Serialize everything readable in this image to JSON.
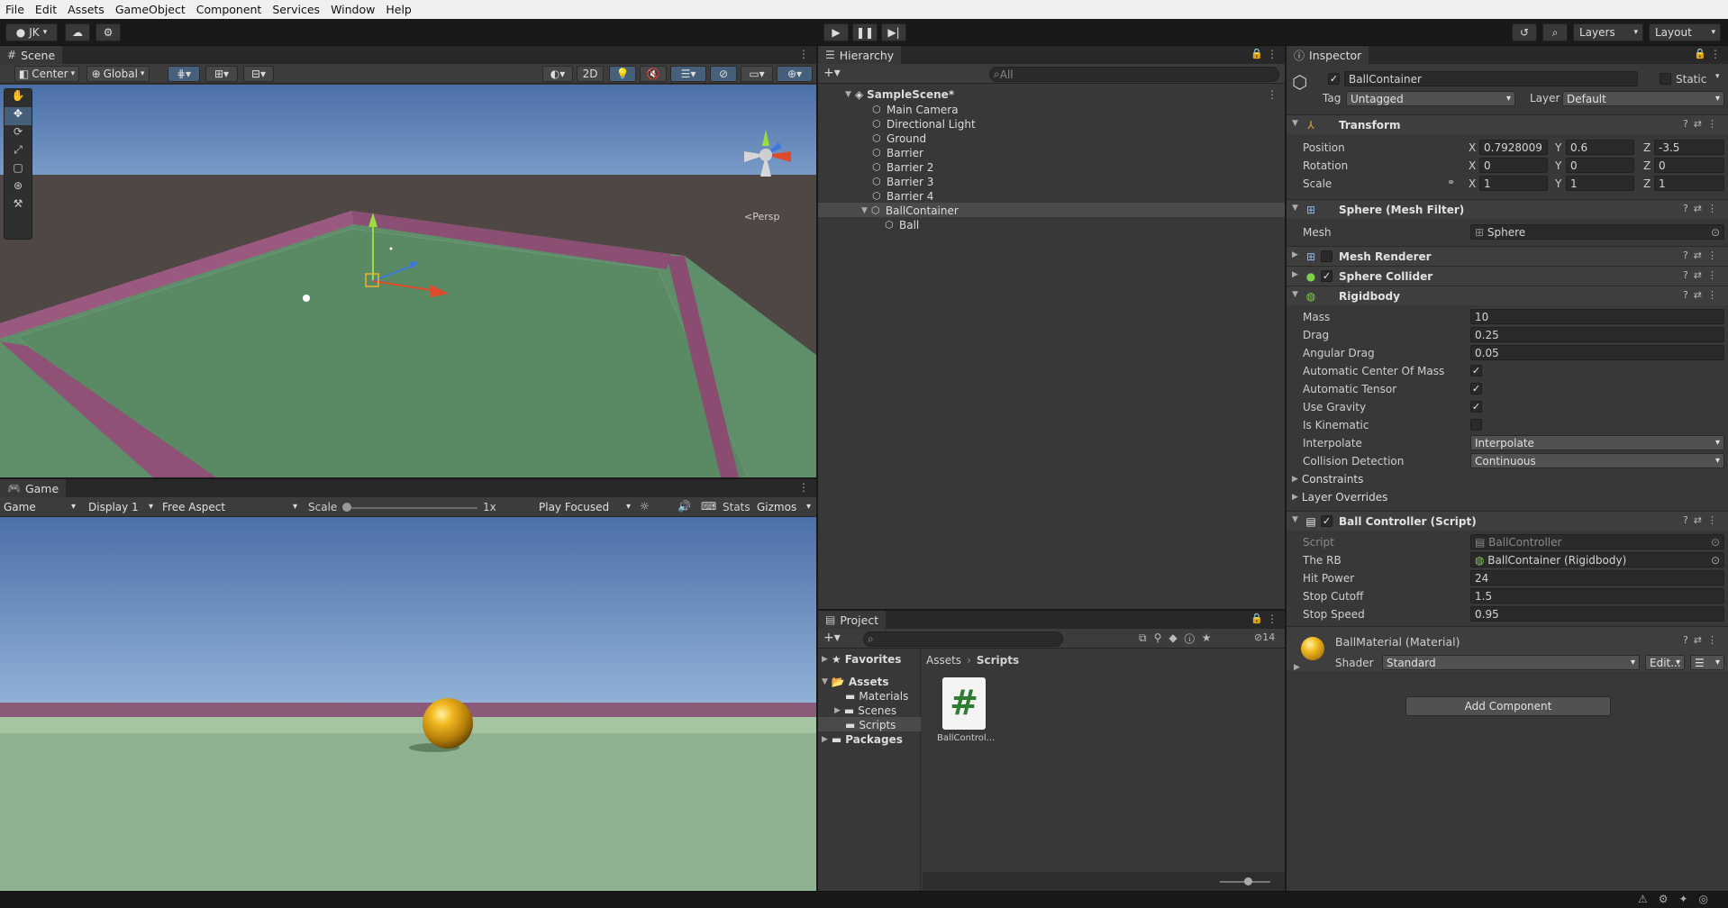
{
  "menu": [
    "File",
    "Edit",
    "Assets",
    "GameObject",
    "Component",
    "Services",
    "Window",
    "Help"
  ],
  "toolbar": {
    "account": "JK",
    "layers": "Layers",
    "layout": "Layout"
  },
  "scene": {
    "tab": "Scene",
    "pivot": "Center",
    "space": "Global",
    "mode2d": "2D",
    "gizmo_label": "<Persp"
  },
  "game": {
    "tab": "Game",
    "mode": "Game",
    "display": "Display 1",
    "aspect": "Free Aspect",
    "scale_label": "Scale",
    "scale_value": "1x",
    "play_mode": "Play Focused",
    "stats": "Stats",
    "gizmos": "Gizmos"
  },
  "hierarchy": {
    "tab": "Hierarchy",
    "search_placeholder": "All",
    "scene": "SampleScene*",
    "items": [
      "Main Camera",
      "Directional Light",
      "Ground",
      "Barrier",
      "Barrier 2",
      "Barrier 3",
      "Barrier 4",
      "BallContainer",
      "Ball"
    ]
  },
  "project": {
    "tab": "Project",
    "hidden_count": "14",
    "favorites": "Favorites",
    "assets": "Assets",
    "folders": [
      "Materials",
      "Scenes",
      "Scripts"
    ],
    "packages": "Packages",
    "breadcrumb": [
      "Assets",
      "Scripts"
    ],
    "file": "BallControl..."
  },
  "inspector": {
    "tab": "Inspector",
    "object_name": "BallContainer",
    "static_label": "Static",
    "tag_label": "Tag",
    "tag": "Untagged",
    "layer_label": "Layer",
    "layer": "Default",
    "transform": {
      "title": "Transform",
      "position": {
        "label": "Position",
        "x": "0.7928009",
        "y": "0.6",
        "z": "-3.5"
      },
      "rotation": {
        "label": "Rotation",
        "x": "0",
        "y": "0",
        "z": "0"
      },
      "scale": {
        "label": "Scale",
        "x": "1",
        "y": "1",
        "z": "1"
      }
    },
    "mesh_filter": {
      "title": "Sphere (Mesh Filter)",
      "mesh_label": "Mesh",
      "mesh": "Sphere"
    },
    "mesh_renderer": {
      "title": "Mesh Renderer"
    },
    "sphere_collider": {
      "title": "Sphere Collider"
    },
    "rigidbody": {
      "title": "Rigidbody",
      "mass_label": "Mass",
      "mass": "10",
      "drag_label": "Drag",
      "drag": "0.25",
      "angular_drag_label": "Angular Drag",
      "angular_drag": "0.05",
      "auto_com_label": "Automatic Center Of Mass",
      "auto_tensor_label": "Automatic Tensor",
      "gravity_label": "Use Gravity",
      "kinematic_label": "Is Kinematic",
      "interpolate_label": "Interpolate",
      "interpolate": "Interpolate",
      "collision_label": "Collision Detection",
      "collision": "Continuous",
      "constraints": "Constraints",
      "layer_overrides": "Layer Overrides"
    },
    "ball_controller": {
      "title": "Ball Controller (Script)",
      "script_label": "Script",
      "script": "BallController",
      "rb_label": "The RB",
      "rb": "BallContainer (Rigidbody)",
      "hit_power_label": "Hit Power",
      "hit_power": "24",
      "stop_cutoff_label": "Stop Cutoff",
      "stop_cutoff": "1.5",
      "stop_speed_label": "Stop Speed",
      "stop_speed": "0.95"
    },
    "material": {
      "title": "BallMaterial (Material)",
      "shader_label": "Shader",
      "shader": "Standard",
      "edit": "Edit..."
    },
    "add_component": "Add Component"
  }
}
